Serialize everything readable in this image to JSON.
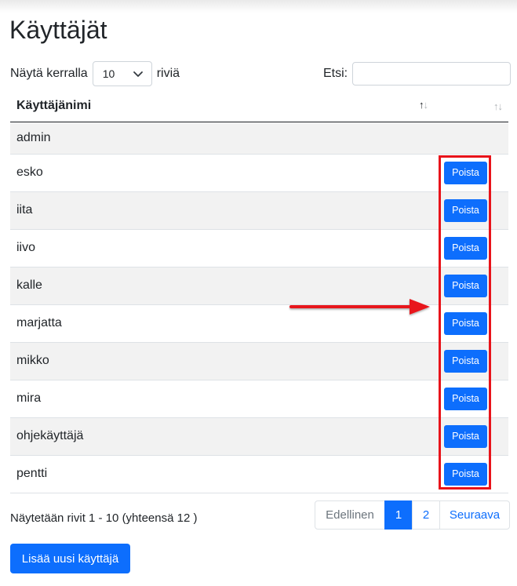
{
  "page": {
    "title": "Käyttäjät"
  },
  "length_menu": {
    "prefix": "Näytä kerralla",
    "selected": "10",
    "suffix": "riviä"
  },
  "search": {
    "label": "Etsi:",
    "value": "",
    "placeholder": ""
  },
  "table": {
    "columns": [
      "Käyttäjänimi",
      ""
    ],
    "rows": [
      {
        "username": "admin",
        "action": ""
      },
      {
        "username": "esko",
        "action": "Poista"
      },
      {
        "username": "iita",
        "action": "Poista"
      },
      {
        "username": "iivo",
        "action": "Poista"
      },
      {
        "username": "kalle",
        "action": "Poista"
      },
      {
        "username": "marjatta",
        "action": "Poista"
      },
      {
        "username": "mikko",
        "action": "Poista"
      },
      {
        "username": "mira",
        "action": "Poista"
      },
      {
        "username": "ohjekäyttäjä",
        "action": "Poista"
      },
      {
        "username": "pentti",
        "action": "Poista"
      }
    ]
  },
  "info": "Näytetään rivit 1 - 10 (yhteensä 12 )",
  "pagination": {
    "previous": "Edellinen",
    "pages": [
      "1",
      "2"
    ],
    "current": "1",
    "next": "Seuraava"
  },
  "add_button": "Lisää uusi käyttäjä",
  "icons": {
    "sort": "sort-arrows-icon",
    "select": "chevron-down-icon",
    "annotation": "arrow-right-icon"
  },
  "colors": {
    "primary": "#0d6efd",
    "annotation": "#e8131a",
    "stripe": "#f2f2f2"
  }
}
